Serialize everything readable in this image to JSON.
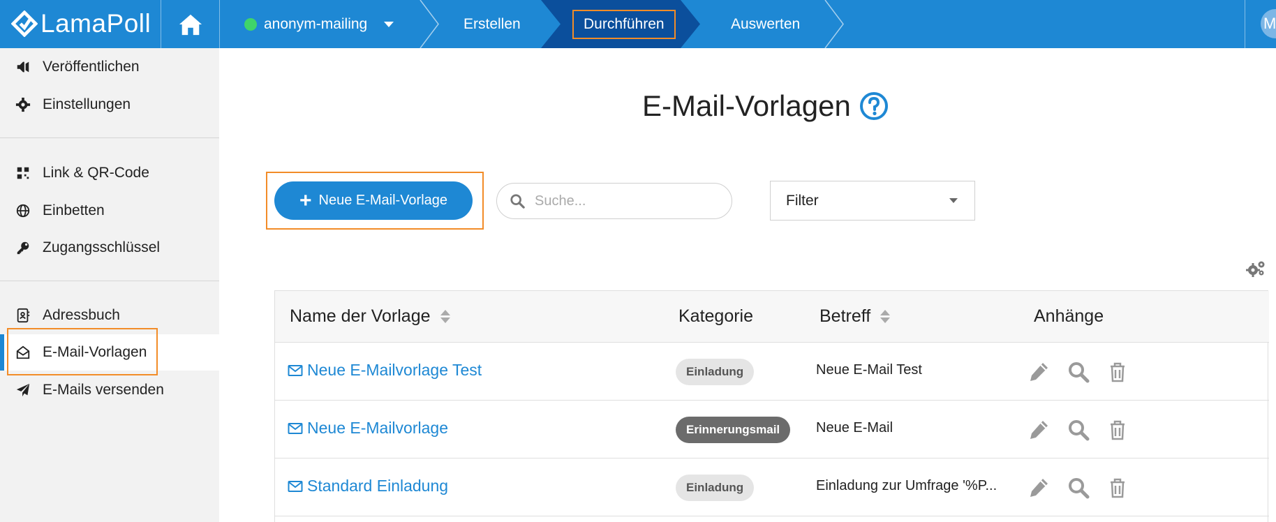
{
  "app": {
    "logo_text": "LamaPoll",
    "avatar_initial": "M"
  },
  "breadcrumb": {
    "project": "anonym-mailing",
    "steps": [
      "Erstellen",
      "Durchführen",
      "Auswerten"
    ],
    "active_step": "Durchführen"
  },
  "sidebar": {
    "groups": [
      [
        {
          "label": "Veröffentlichen",
          "icon": "megaphone-icon"
        },
        {
          "label": "Einstellungen",
          "icon": "gear-icon"
        }
      ],
      [
        {
          "label": "Link & QR-Code",
          "icon": "qr-code-icon"
        },
        {
          "label": "Einbetten",
          "icon": "globe-icon"
        },
        {
          "label": "Zugangsschlüssel",
          "icon": "key-icon"
        }
      ],
      [
        {
          "label": "Adressbuch",
          "icon": "address-book-icon"
        },
        {
          "label": "E-Mail-Vorlagen",
          "icon": "envelope-open-icon",
          "active": true
        },
        {
          "label": "E-Mails versenden",
          "icon": "paper-plane-icon"
        }
      ]
    ]
  },
  "main": {
    "title": "E-Mail-Vorlagen",
    "new_button_label": "Neue E-Mail-Vorlage",
    "search_placeholder": "Suche...",
    "filter_label": "Filter"
  },
  "table": {
    "columns": [
      "Name der Vorlage",
      "Kategorie",
      "Betreff",
      "Anhänge"
    ],
    "rows": [
      {
        "name": "Neue E-Mailvorlage Test",
        "category": "Einladung",
        "category_style": "light",
        "subject": "Neue E-Mail Test"
      },
      {
        "name": "Neue E-Mailvorlage",
        "category": "Erinnerungsmail",
        "category_style": "dark",
        "subject": "Neue E-Mail"
      },
      {
        "name": "Standard Einladung",
        "category": "Einladung",
        "category_style": "light",
        "subject": "Einladung zur Umfrage '%P..."
      }
    ]
  },
  "colors": {
    "primary": "#1e88d4",
    "active_step": "#0b4f9c",
    "highlight": "#f28c28",
    "status_dot": "#3fd46a"
  }
}
